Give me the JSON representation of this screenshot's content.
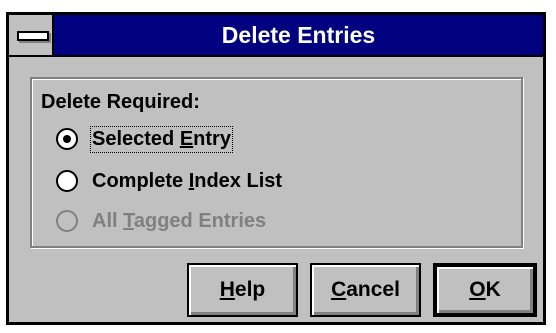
{
  "dialog": {
    "title": "Delete Entries",
    "group_label": "Delete Required:",
    "options": [
      {
        "pre": "Selected ",
        "accel": "E",
        "post": "ntry",
        "checked": true,
        "disabled": false,
        "focused": true
      },
      {
        "pre": "Complete ",
        "accel": "I",
        "post": "ndex List",
        "checked": false,
        "disabled": false,
        "focused": false
      },
      {
        "pre": "All ",
        "accel": "T",
        "post": "agged Entries",
        "checked": false,
        "disabled": true,
        "focused": false
      }
    ],
    "buttons": {
      "help": {
        "accel": "H",
        "rest": "elp"
      },
      "cancel": {
        "accel": "C",
        "rest": "ancel"
      },
      "ok": {
        "accel": "O",
        "rest": "K"
      }
    }
  }
}
